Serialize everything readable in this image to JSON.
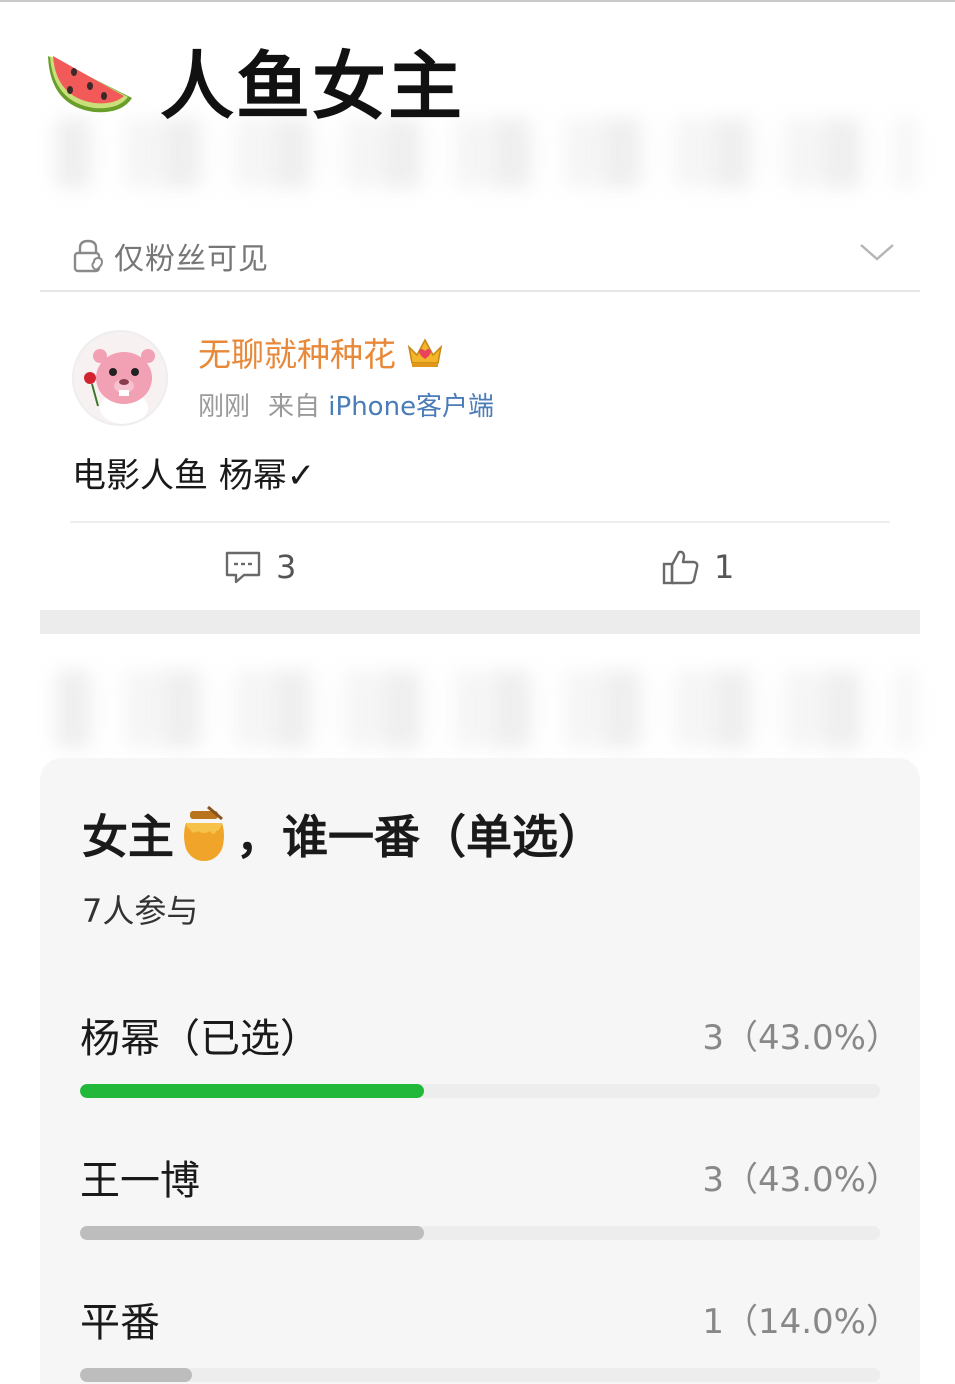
{
  "header": {
    "title": "人鱼女主",
    "emoji_icon": "watermelon-icon"
  },
  "visibility": {
    "label": "仅粉丝可见",
    "icon": "lock-heart-icon"
  },
  "post": {
    "username": "无聊就种种花",
    "badge_icon": "crown-icon",
    "time": "刚刚",
    "source_prefix": "来自",
    "source_device": "iPhone客户端",
    "text": "电影人鱼 杨幂✓",
    "comments_count": "3",
    "likes_count": "1"
  },
  "poll": {
    "title_prefix": "女主",
    "title_emoji_icon": "honey-pot-icon",
    "title_suffix": "，谁一番（单选）",
    "participants": "7人参与",
    "options": [
      {
        "label": "杨幂（已选）",
        "stats": "3（43.0%）",
        "fraction": 0.43,
        "color": "#22b83a"
      },
      {
        "label": "王一博",
        "stats": "3（43.0%）",
        "fraction": 0.43,
        "color": "#bdbdbd"
      },
      {
        "label": "平番",
        "stats": "1（14.0%）",
        "fraction": 0.14,
        "color": "#bdbdbd"
      }
    ]
  },
  "colors": {
    "username": "#e8893a",
    "device_link": "#4a7cb8",
    "selected_bar": "#22b83a",
    "other_bar": "#bdbdbd"
  }
}
